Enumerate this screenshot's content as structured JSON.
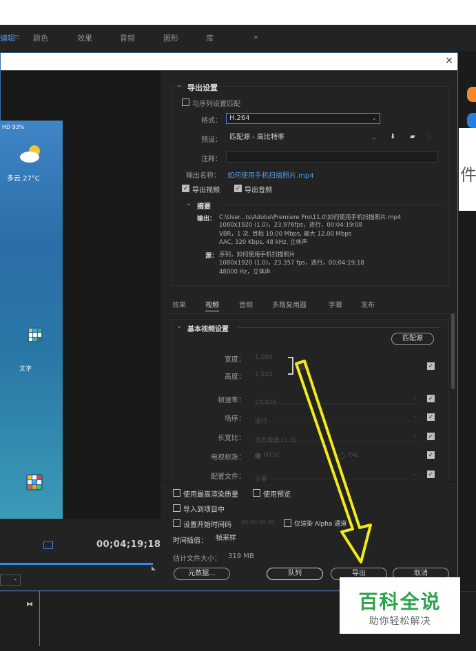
{
  "workspace": {
    "tabs": [
      "编辑",
      "颜色",
      "效果",
      "音频",
      "图形",
      "库"
    ],
    "more": "»"
  },
  "dialog": {
    "close": "×"
  },
  "preview": {
    "status": "HD 93%",
    "weather": "多云 27°C",
    "folder_label": "文字",
    "timecode": "00;04;19;18"
  },
  "export_settings": {
    "header": "导出设置",
    "match_sequence": "与序列设置匹配",
    "format_label": "格式：",
    "format_value": "H.264",
    "preset_label": "预设：",
    "preset_value": "匹配源 - 高比特率",
    "comment_label": "注释：",
    "output_name_label": "输出名称：",
    "output_name_value": "如何使用手机扫描照片.mp4",
    "export_video": "导出视频",
    "export_audio": "导出音频",
    "summary_header": "摘要",
    "output_label": "输出：",
    "output_line1": "C:\\User...ts\\Adobe\\Premiere Pro\\11.0\\如何使用手机扫描照片.mp4",
    "output_line2": "1080x1920 (1.0)，23.976fps，逐行，00:04:19:08",
    "output_line3": "VBR，1 次, 目标 10.00 Mbps, 最大 12.00 Mbps",
    "output_line4": "AAC, 320 Kbps, 48 kHz, 立体声",
    "source_label": "源：",
    "source_line1": "序列，如何使用手机扫描照片",
    "source_line2": "1080x1920 (1.0)，23.357 fps，逐行，00;04;19;18",
    "source_line3": "48000 Hz，立体声"
  },
  "tabs": [
    "效果",
    "视频",
    "音频",
    "多路复用器",
    "字幕",
    "发布"
  ],
  "video": {
    "header": "基本视频设置",
    "match_source": "匹配源",
    "width_label": "宽度：",
    "width_value": "1,080",
    "height_label": "高度：",
    "height_value": "1,920",
    "frame_rate_label": "帧速率：",
    "frame_rate_value": "23.976",
    "field_order_label": "场序：",
    "field_order_value": "逐行",
    "aspect_label": "长宽比：",
    "aspect_value": "方形像素 (1.0)",
    "tv_standard_label": "电视标准：",
    "ntsc": "NTSC",
    "pal": "PAL",
    "profile_label": "配置文件：",
    "profile_value": "主要"
  },
  "bottom": {
    "max_render": "使用最高渲染质量",
    "use_previews": "使用预览",
    "import_project": "导入到项目中",
    "set_start_tc": "设置开始时间码",
    "start_tc_value": "00;00;00;00",
    "render_alpha": "仅渲染 Alpha 通道",
    "interp_label": "时间插值：",
    "interp_value": "帧采样",
    "filesize_label": "估计文件大小：",
    "filesize_value": "319 MB",
    "metadata_btn": "元数据...",
    "queue_btn": "队列",
    "export_btn": "导出",
    "cancel_btn": "取消"
  },
  "edge": {
    "char": "件"
  },
  "watermark": {
    "title": "百科全说",
    "subtitle": "助你轻松解决"
  },
  "colors": {
    "accent": "#4f9bea",
    "highlight": "#f2ea1a",
    "watermark_green": "#2aa44a"
  }
}
